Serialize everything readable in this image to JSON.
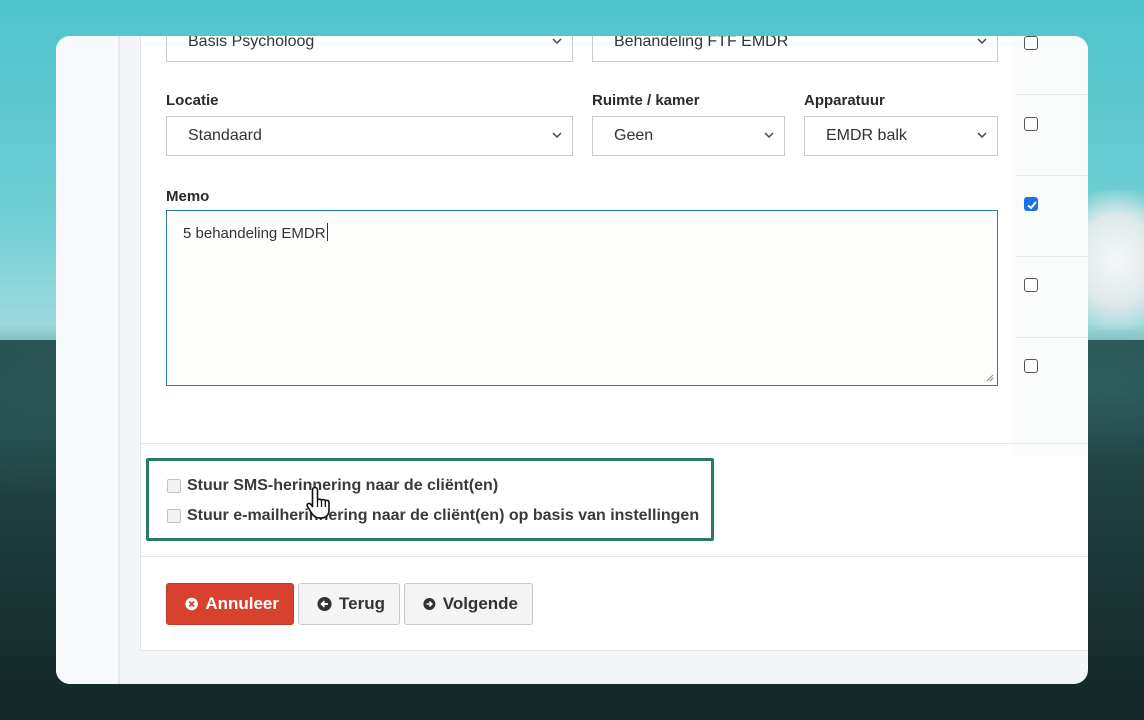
{
  "form": {
    "top_row": {
      "left_select_value": "Basis Psycholoog",
      "right_select_value": "Behandeling FTF EMDR"
    },
    "location": {
      "label": "Locatie",
      "value": "Standaard"
    },
    "room": {
      "label": "Ruimte / kamer",
      "value": "Geen"
    },
    "equipment": {
      "label": "Apparatuur",
      "value": "EMDR balk"
    },
    "memo": {
      "label": "Memo",
      "value": "5 behandeling EMDR"
    }
  },
  "side_checkboxes": [
    false,
    false,
    true,
    false,
    false
  ],
  "reminders": {
    "sms_label": "Stuur SMS-herinnering naar de cliënt(en)",
    "email_label": "Stuur e-mailherinnering naar de cliënt(en) op basis van instellingen",
    "sms_checked": false,
    "email_checked": false
  },
  "buttons": {
    "cancel_label": "Annuleer",
    "back_label": "Terug",
    "next_label": "Volgende"
  },
  "colors": {
    "cancel": "#d9412f",
    "highlight_border": "#2b7a62",
    "checkbox_checked": "#1a73e8"
  },
  "icons": {
    "cancel": "times-circle-icon",
    "back": "arrow-circle-left-icon",
    "next": "arrow-circle-right-icon",
    "cursor": "hand-pointer-icon"
  }
}
